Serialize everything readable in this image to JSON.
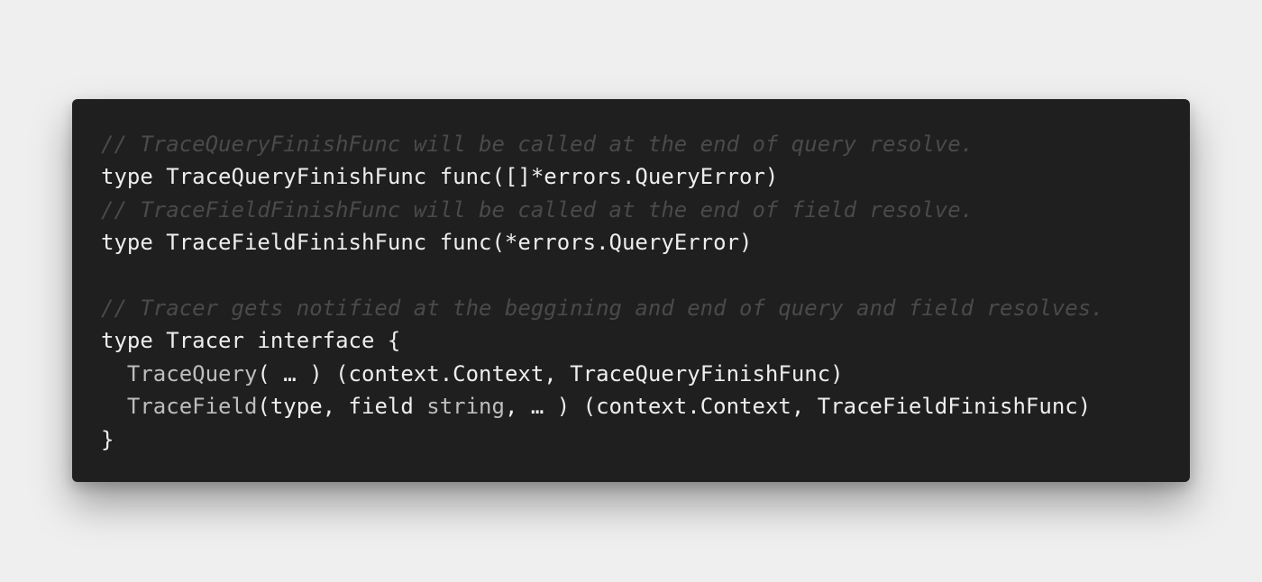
{
  "code": {
    "comment1": "// TraceQueryFinishFunc will be called at the end of query resolve.",
    "line2": {
      "kw": "type",
      "name": "TraceQueryFinishFunc",
      "sig": "func([]*errors.QueryError)"
    },
    "comment2": "// TraceFieldFinishFunc will be called at the end of field resolve.",
    "line4": {
      "kw": "type",
      "name": "TraceFieldFinishFunc",
      "sig": "func(*errors.QueryError)"
    },
    "comment3": "// Tracer gets notified at the beggining and end of query and field resolves.",
    "line7": {
      "kw": "type",
      "name": "Tracer",
      "iface": "interface {"
    },
    "line8": {
      "method": "TraceQuery",
      "args": "( … )",
      "ret": "(context.Context, TraceQueryFinishFunc)"
    },
    "line9": {
      "method": "TraceField",
      "args_start": "(type, field ",
      "builtin": "string",
      "args_end": ", … )",
      "ret": "(context.Context, TraceFieldFinishFunc)"
    },
    "line10": "}"
  }
}
